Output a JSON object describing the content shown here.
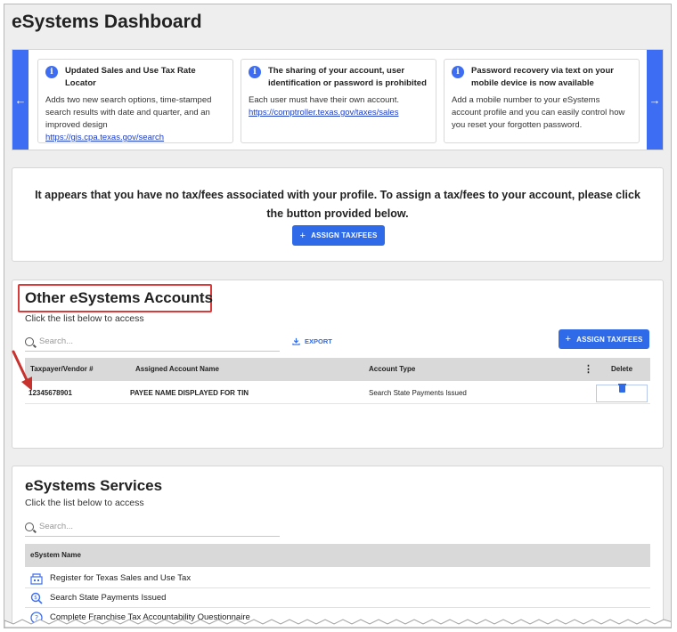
{
  "page": {
    "title": "eSystems Dashboard"
  },
  "carousel": {
    "notices": [
      {
        "title": "Updated Sales and Use Tax Rate Locator",
        "body": "Adds two new search options, time-stamped search results with date and quarter, and an improved design",
        "link": "https://gis.cpa.texas.gov/search"
      },
      {
        "title": "The sharing of your account, user identification or password is prohibited",
        "body": "Each user must have their own account.",
        "link": "https://comptroller.texas.gov/taxes/sales"
      },
      {
        "title": "Password recovery via text on your mobile device is now available",
        "body": "Add a mobile number to your eSystems account profile and you can easily control how you reset your forgotten password.",
        "link": ""
      }
    ]
  },
  "no_tax": {
    "message": "It appears that you have no tax/fees associated with your profile. To assign a tax/fees to your account, please click the button provided below.",
    "button_label": "ASSIGN TAX/FEES"
  },
  "other_accounts": {
    "title": "Other eSystems Accounts",
    "subtitle": "Click the list below to access",
    "search_placeholder": "Search...",
    "export_label": "EXPORT",
    "assign_label": "ASSIGN TAX/FEES",
    "columns": [
      "Taxpayer/Vendor #",
      "Assigned Account Name",
      "Account Type",
      "Delete"
    ],
    "rows": [
      {
        "id": "12345678901",
        "name": "PAYEE NAME DISPLAYED FOR TIN",
        "type": "Search State Payments Issued"
      }
    ]
  },
  "services": {
    "title": "eSystems Services",
    "subtitle": "Click the list below to access",
    "search_placeholder": "Search...",
    "column": "eSystem Name",
    "items": [
      {
        "label": "Register for Texas Sales and Use Tax",
        "icon": "building-icon"
      },
      {
        "label": "Search State Payments Issued",
        "icon": "search-dollar-icon"
      },
      {
        "label": "Complete Franchise Tax Accountability Questionnaire",
        "icon": "question-icon"
      }
    ]
  },
  "colors": {
    "accent": "#2f6ae8",
    "annotation": "#d93a3a"
  }
}
